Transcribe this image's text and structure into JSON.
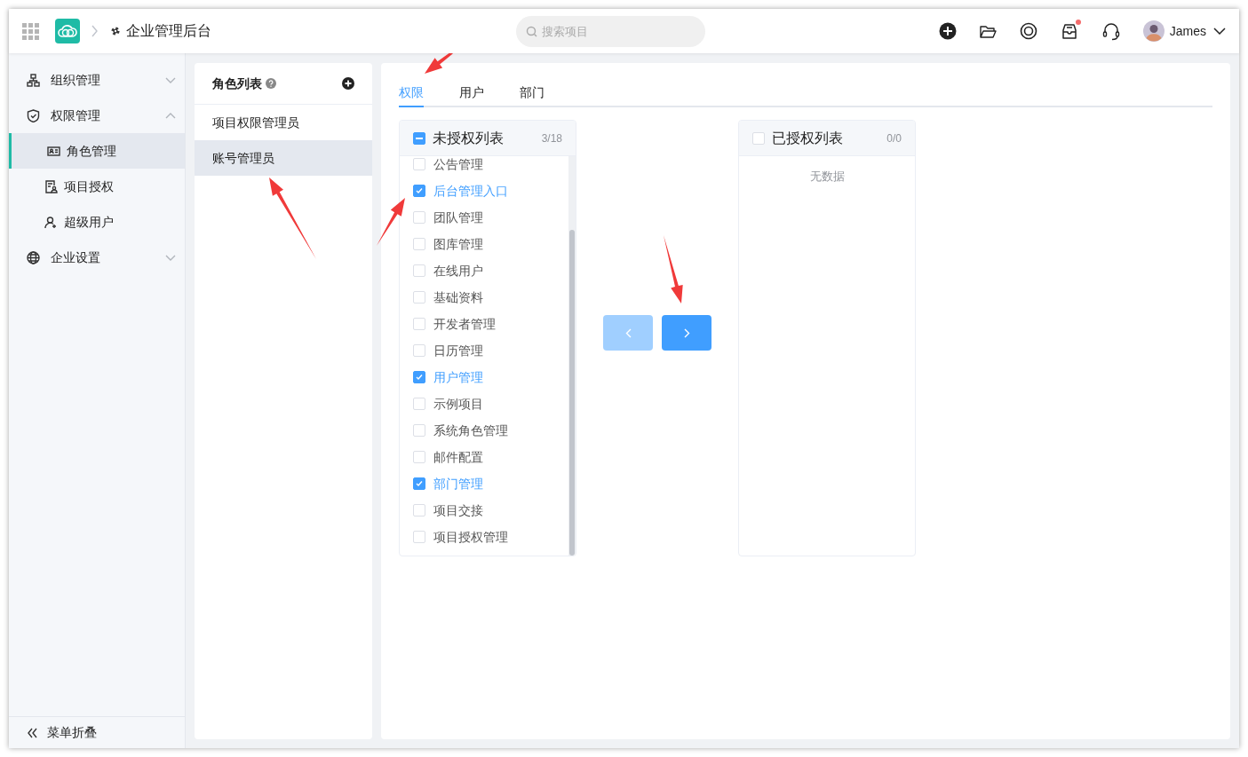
{
  "header": {
    "title": "企业管理后台",
    "search": {
      "placeholder": "搜索项目"
    },
    "notification_dot": true,
    "user": {
      "name": "James"
    }
  },
  "sidebar": {
    "items": [
      {
        "label": "组织管理",
        "expanded": false,
        "selected": false
      },
      {
        "label": "权限管理",
        "expanded": true,
        "selected": false,
        "children": [
          {
            "label": "角色管理",
            "selected": true
          },
          {
            "label": "项目授权",
            "selected": false
          },
          {
            "label": "超级用户",
            "selected": false
          }
        ]
      },
      {
        "label": "企业设置",
        "expanded": false,
        "selected": false
      }
    ],
    "collapse_label": "菜单折叠"
  },
  "roles": {
    "title": "角色列表",
    "items": [
      {
        "label": "项目权限管理员",
        "selected": false
      },
      {
        "label": "账号管理员",
        "selected": true
      }
    ]
  },
  "tabs": [
    {
      "label": "权限",
      "selected": true
    },
    {
      "label": "用户",
      "selected": false
    },
    {
      "label": "部门",
      "selected": false
    }
  ],
  "transfer": {
    "left": {
      "title": "未授权列表",
      "count": "3/18",
      "checked": false,
      "indeterminate": true,
      "items": [
        {
          "label": "公告管理",
          "checked": false
        },
        {
          "label": "后台管理入口",
          "checked": true
        },
        {
          "label": "团队管理",
          "checked": false
        },
        {
          "label": "图库管理",
          "checked": false
        },
        {
          "label": "在线用户",
          "checked": false
        },
        {
          "label": "基础资料",
          "checked": false
        },
        {
          "label": "开发者管理",
          "checked": false
        },
        {
          "label": "日历管理",
          "checked": false
        },
        {
          "label": "用户管理",
          "checked": true
        },
        {
          "label": "示例项目",
          "checked": false
        },
        {
          "label": "系统角色管理",
          "checked": false
        },
        {
          "label": "邮件配置",
          "checked": false
        },
        {
          "label": "部门管理",
          "checked": true
        },
        {
          "label": "项目交接",
          "checked": false
        },
        {
          "label": "项目授权管理",
          "checked": false
        }
      ]
    },
    "buttons": [
      {
        "kind": "left",
        "disabled": true
      },
      {
        "kind": "right",
        "disabled": false
      }
    ],
    "right": {
      "title": "已授权列表",
      "count": "0/0",
      "checked": false,
      "indeterminate": false,
      "empty_text": "无数据"
    }
  }
}
